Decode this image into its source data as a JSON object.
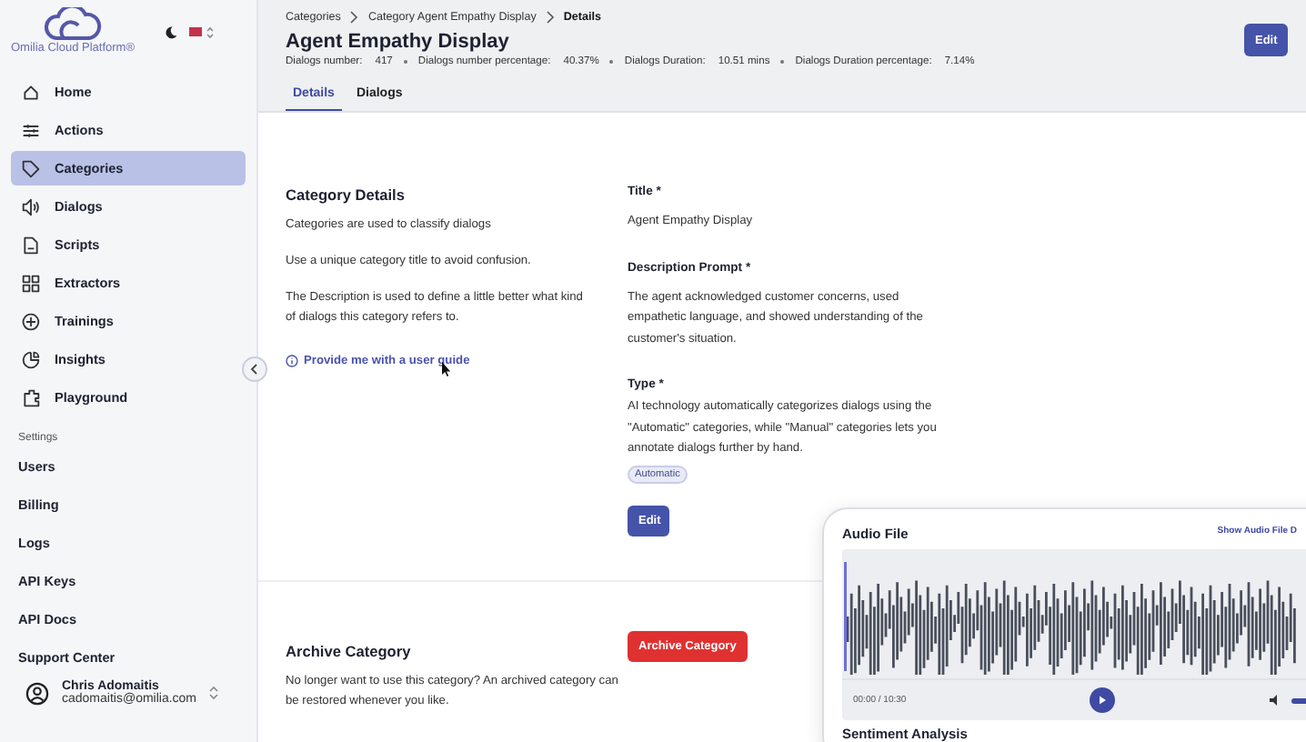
{
  "sidebar": {
    "brand": "Omilia Cloud Platform®",
    "nav": [
      {
        "label": "Home",
        "selected": false
      },
      {
        "label": "Actions",
        "selected": false
      },
      {
        "label": "Categories",
        "selected": true
      },
      {
        "label": "Dialogs",
        "selected": false
      },
      {
        "label": "Scripts",
        "selected": false
      },
      {
        "label": "Extractors",
        "selected": false
      },
      {
        "label": "Trainings",
        "selected": false
      },
      {
        "label": "Insights",
        "selected": false
      },
      {
        "label": "Playground",
        "selected": false
      }
    ],
    "settings_label": "Settings",
    "settings_items": [
      "Users",
      "Billing",
      "Logs",
      "API Keys",
      "API Docs",
      "Support Center"
    ],
    "user": {
      "name": "Chris Adomaitis",
      "email": "cadomaitis@omilia.com"
    }
  },
  "header": {
    "breadcrumb": [
      "Categories",
      "Category Agent Empathy Display",
      "Details"
    ],
    "title": "Agent Empathy Display",
    "stats": [
      {
        "label": "Dialogs number:",
        "value": "417"
      },
      {
        "label": "Dialogs number percentage:",
        "value": "40.37%"
      },
      {
        "label": "Dialogs Duration:",
        "value": "10.51 mins"
      },
      {
        "label": "Dialogs Duration percentage:",
        "value": "7.14%"
      }
    ],
    "edit_button": "Edit",
    "tabs": [
      {
        "label": "Details",
        "selected": true
      },
      {
        "label": "Dialogs",
        "selected": false
      }
    ]
  },
  "details": {
    "heading": "Category Details",
    "paragraphs": [
      "Categories are used to classify dialogs",
      "Use a unique category title to avoid confusion.",
      "The Description is used to define a little better what kind of dialogs this category refers to."
    ],
    "guide_link": "Provide me with a user guide"
  },
  "fields": {
    "title_label": "Title *",
    "title_value": "Agent Empathy Display",
    "description_label": "Description Prompt *",
    "description_value": "The agent acknowledged customer concerns, used empathetic language, and showed understanding of the customer's situation.",
    "type_label": "Type *",
    "type_help": "AI technology automatically categorizes dialogs using the \"Automatic\" categories, while \"Manual\" categories lets you annotate dialogs further by hand.",
    "type_tag": "Automatic",
    "edit_button": "Edit"
  },
  "archive": {
    "heading": "Archive Category",
    "text": "No longer want to use this category? An archived category can be restored whenever you like.",
    "button": "Archive Category"
  },
  "audio_card": {
    "title": "Audio File",
    "link": "Show Audio File D",
    "time": "00:00 / 10:30",
    "next_heading": "Sentiment Analysis"
  }
}
